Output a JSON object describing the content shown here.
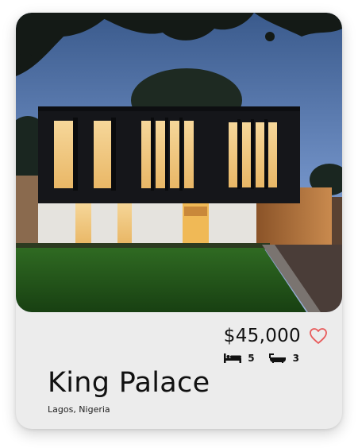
{
  "listing": {
    "price": "$45,000",
    "bedrooms": "5",
    "bathrooms": "3",
    "title": "King Palace",
    "location": "Lagos, Nigeria",
    "favorited": false
  },
  "icons": {
    "favorite": "heart-icon",
    "bedrooms": "bed-icon",
    "bathrooms": "bathtub-icon"
  },
  "colors": {
    "card_background": "#ececec",
    "heart": "#e85a5a",
    "text": "#111111"
  }
}
